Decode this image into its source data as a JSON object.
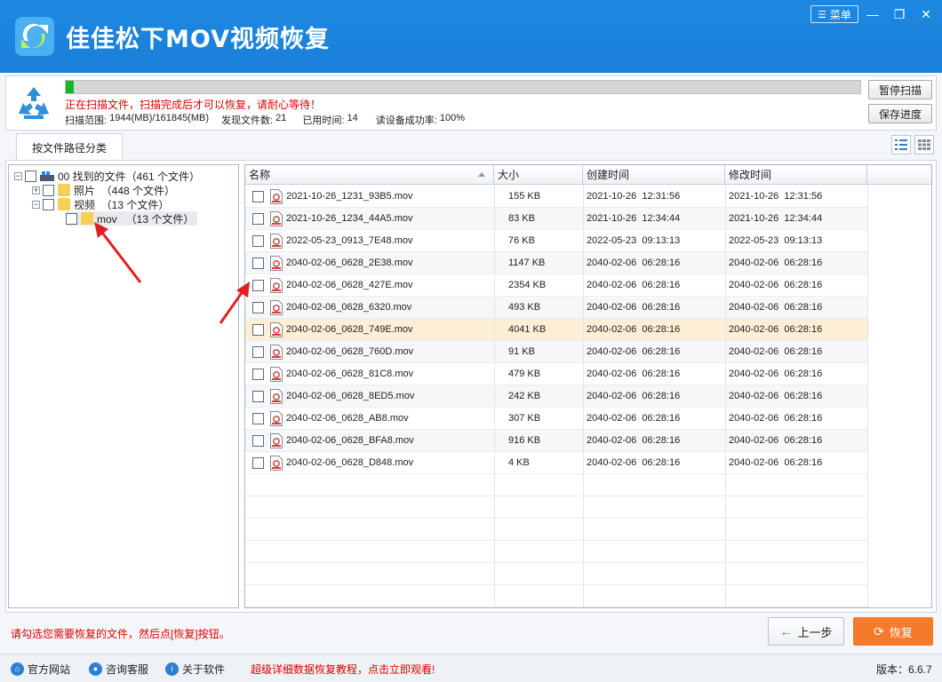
{
  "app": {
    "title": "佳佳松下MOV视频恢复",
    "menu_label": "菜单",
    "minimize": "—",
    "restore": "❐",
    "close": "✕"
  },
  "scan": {
    "progress_percent": 1,
    "warning": "正在扫描文件，扫描完成后才可以恢复，请耐心等待！",
    "range_label": "扫描范围: ",
    "range_value": "1944(MB)/161845(MB)",
    "found_label": "发现文件数: ",
    "found_value": "21",
    "time_label": "已用时间: ",
    "time_value": "14",
    "rate_label": "读设备成功率: ",
    "rate_value": "100%",
    "pause_button": "暂停扫描",
    "save_button": "保存进度"
  },
  "tabs": {
    "path_tab": "按文件路径分类"
  },
  "tree": {
    "root": "00 找到的文件（461 个文件）",
    "photos": "照片  （448 个文件）",
    "videos": "视频  （13 个文件）",
    "mov": "mov   （13 个文件）"
  },
  "table": {
    "headers": [
      "名称",
      "大小",
      "创建时间",
      "修改时间"
    ],
    "rows": [
      {
        "name": "2021-10-26_1231_93B5.mov",
        "size": "155 KB",
        "created": "2021-10-26  12:31:56",
        "modified": "2021-10-26  12:31:56"
      },
      {
        "name": "2021-10-26_1234_44A5.mov",
        "size": "83 KB",
        "created": "2021-10-26  12:34:44",
        "modified": "2021-10-26  12:34:44"
      },
      {
        "name": "2022-05-23_0913_7E48.mov",
        "size": "76 KB",
        "created": "2022-05-23  09:13:13",
        "modified": "2022-05-23  09:13:13"
      },
      {
        "name": "2040-02-06_0628_2E38.mov",
        "size": "1147 KB",
        "created": "2040-02-06  06:28:16",
        "modified": "2040-02-06  06:28:16"
      },
      {
        "name": "2040-02-06_0628_427E.mov",
        "size": "2354 KB",
        "created": "2040-02-06  06:28:16",
        "modified": "2040-02-06  06:28:16"
      },
      {
        "name": "2040-02-06_0628_6320.mov",
        "size": "493 KB",
        "created": "2040-02-06  06:28:16",
        "modified": "2040-02-06  06:28:16"
      },
      {
        "name": "2040-02-06_0628_749E.mov",
        "size": "4041 KB",
        "created": "2040-02-06  06:28:16",
        "modified": "2040-02-06  06:28:16"
      },
      {
        "name": "2040-02-06_0628_760D.mov",
        "size": "91 KB",
        "created": "2040-02-06  06:28:16",
        "modified": "2040-02-06  06:28:16"
      },
      {
        "name": "2040-02-06_0628_81C8.mov",
        "size": "479 KB",
        "created": "2040-02-06  06:28:16",
        "modified": "2040-02-06  06:28:16"
      },
      {
        "name": "2040-02-06_0628_8ED5.mov",
        "size": "242 KB",
        "created": "2040-02-06  06:28:16",
        "modified": "2040-02-06  06:28:16"
      },
      {
        "name": "2040-02-06_0628_AB8.mov",
        "size": "307 KB",
        "created": "2040-02-06  06:28:16",
        "modified": "2040-02-06  06:28:16"
      },
      {
        "name": "2040-02-06_0628_BFA8.mov",
        "size": "916 KB",
        "created": "2040-02-06  06:28:16",
        "modified": "2040-02-06  06:28:16"
      },
      {
        "name": "2040-02-06_0628_D848.mov",
        "size": "4 KB",
        "created": "2040-02-06  06:28:16",
        "modified": "2040-02-06  06:28:16"
      }
    ]
  },
  "footer": {
    "hint": "请勾选您需要恢复的文件，然后点[恢复]按钮。",
    "back_button": "上一步",
    "recover_button": "恢复"
  },
  "statusbar": {
    "website": "官方网站",
    "support": "咨询客服",
    "about": "关于软件",
    "promo": "超级详细数据恢复教程，点击立即观看!",
    "version": "版本：6.6.7"
  },
  "colors": {
    "titlebar": "#1e88e0",
    "progress": "#15b824",
    "warning_text": "#e00000",
    "recover_button": "#f57a2a",
    "selected_row": "#fcefd6",
    "annotation_arrow": "#e02020"
  }
}
